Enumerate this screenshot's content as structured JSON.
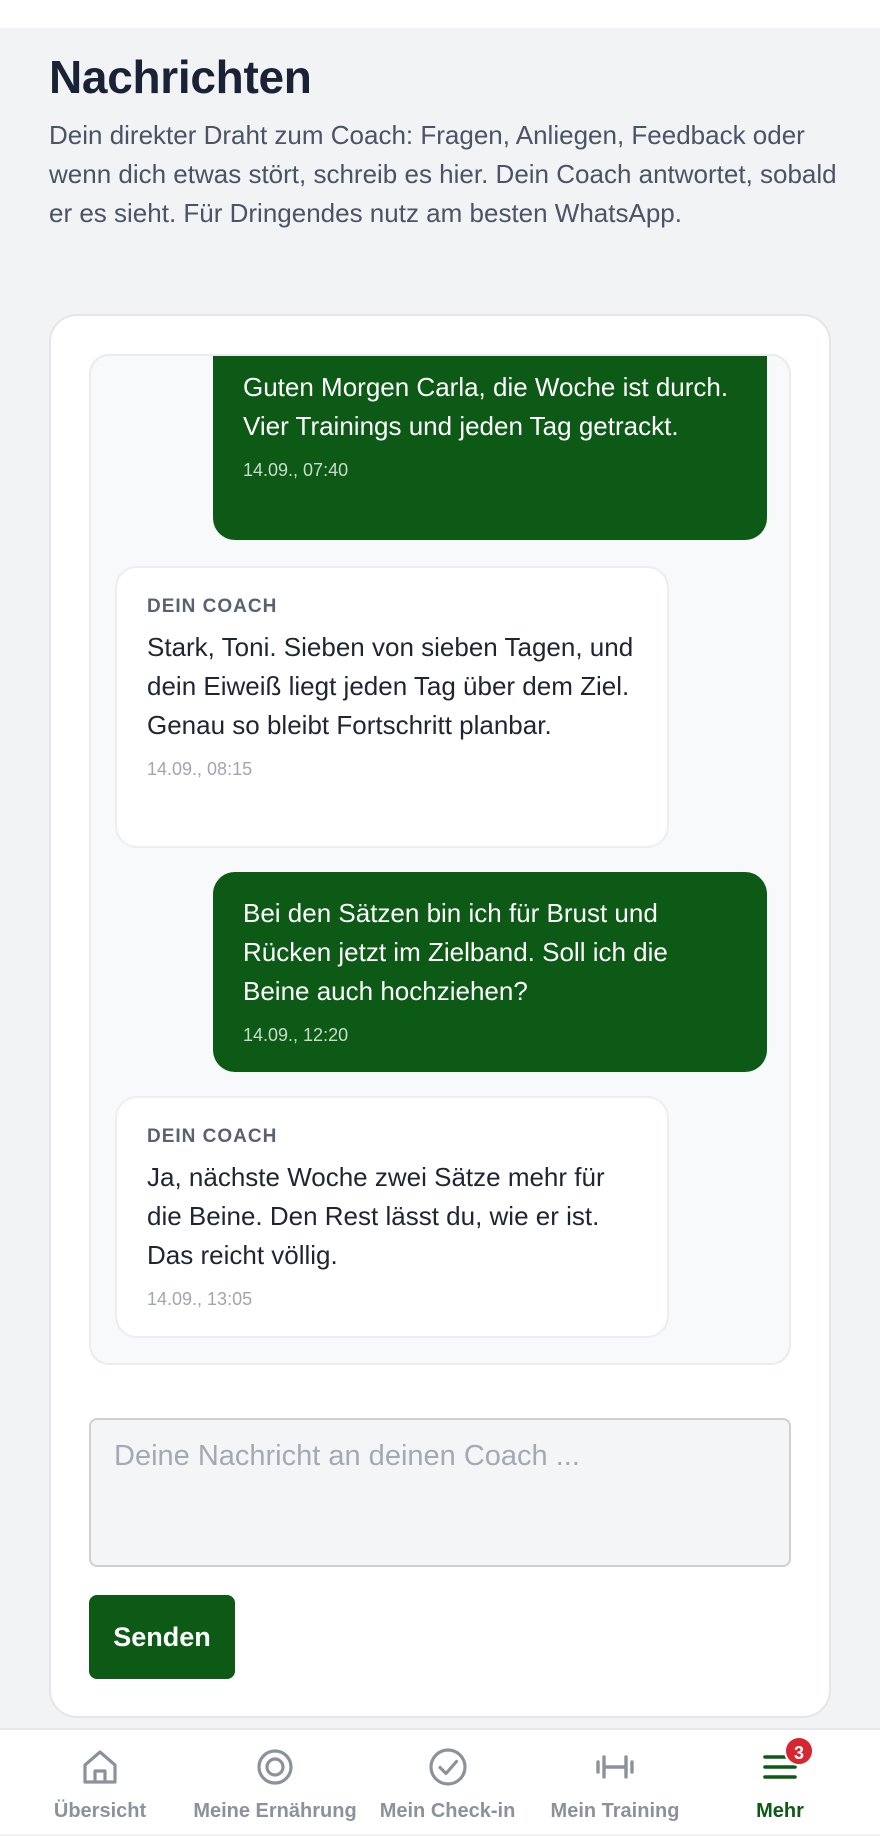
{
  "header": {
    "title": "Nachrichten",
    "description": "Dein direkter Draht zum Coach: Fragen, Anliegen, Feedback oder wenn dich etwas stört, schreib es hier. Dein Coach antwortet, sobald er es sieht. Für Dringendes nutz am besten WhatsApp."
  },
  "messages": [
    {
      "direction": "outgoing",
      "text": "Guten Morgen Carla, die Woche ist durch. Vier Trainings und jeden Tag getrackt.",
      "time": "14.09., 07:40"
    },
    {
      "direction": "incoming",
      "sender": "DEIN COACH",
      "text": "Stark, Toni. Sieben von sieben Tagen, und dein Eiweiß liegt jeden Tag über dem Ziel. Genau so bleibt Fortschritt planbar.",
      "time": "14.09., 08:15"
    },
    {
      "direction": "outgoing",
      "text": "Bei den Sätzen bin ich für Brust und Rücken jetzt im Zielband. Soll ich die Beine auch hochziehen?",
      "time": "14.09., 12:20"
    },
    {
      "direction": "incoming",
      "sender": "DEIN COACH",
      "text": "Ja, nächste Woche zwei Sätze mehr für die Beine. Den Rest lässt du, wie er ist. Das reicht völlig.",
      "time": "14.09., 13:05"
    }
  ],
  "composer": {
    "value": "",
    "placeholder": "Deine Nachricht an deinen Coach ...",
    "send_label": "Senden"
  },
  "tabbar": {
    "items": [
      {
        "label": "Übersicht",
        "icon": "home-icon"
      },
      {
        "label": "Meine Ernährung",
        "icon": "target-icon"
      },
      {
        "label": "Mein Check-in",
        "icon": "check-circle-icon"
      },
      {
        "label": "Mein Training",
        "icon": "dumbbell-icon"
      },
      {
        "label": "Mehr",
        "icon": "menu-icon",
        "badge": "3",
        "active": true
      }
    ]
  },
  "colors": {
    "accent": "#0c5a16",
    "badge": "#d6262f",
    "background": "#f2f3f5"
  }
}
